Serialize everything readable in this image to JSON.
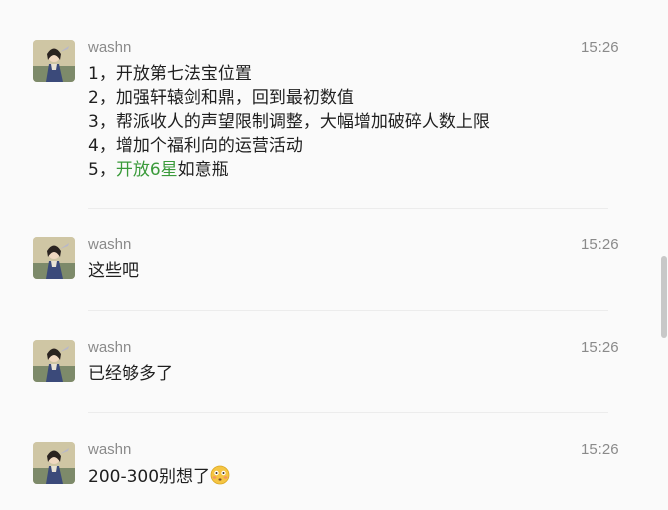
{
  "messages": [
    {
      "sender": "washn",
      "time": "15:26",
      "lines": [
        "1，开放第七法宝位置",
        "2，加强轩辕剑和鼎，回到最初数值",
        "3，帮派收人的声望限制调整，大幅增加破碎人数上限",
        "4，增加个福利向的运营活动"
      ],
      "line5": {
        "prefix": "5，",
        "highlight": "开放6星",
        "suffix": "如意瓶"
      }
    },
    {
      "sender": "washn",
      "time": "15:26",
      "text": "这些吧"
    },
    {
      "sender": "washn",
      "time": "15:26",
      "text": "已经够多了"
    },
    {
      "sender": "washn",
      "time": "15:26",
      "text": "200-300别想了",
      "emoji": "flushed-face-emoji"
    }
  ],
  "colors": {
    "highlight": "#3a9a3a",
    "meta_text": "#8a8a8a",
    "message_text": "#1f1f1f"
  }
}
